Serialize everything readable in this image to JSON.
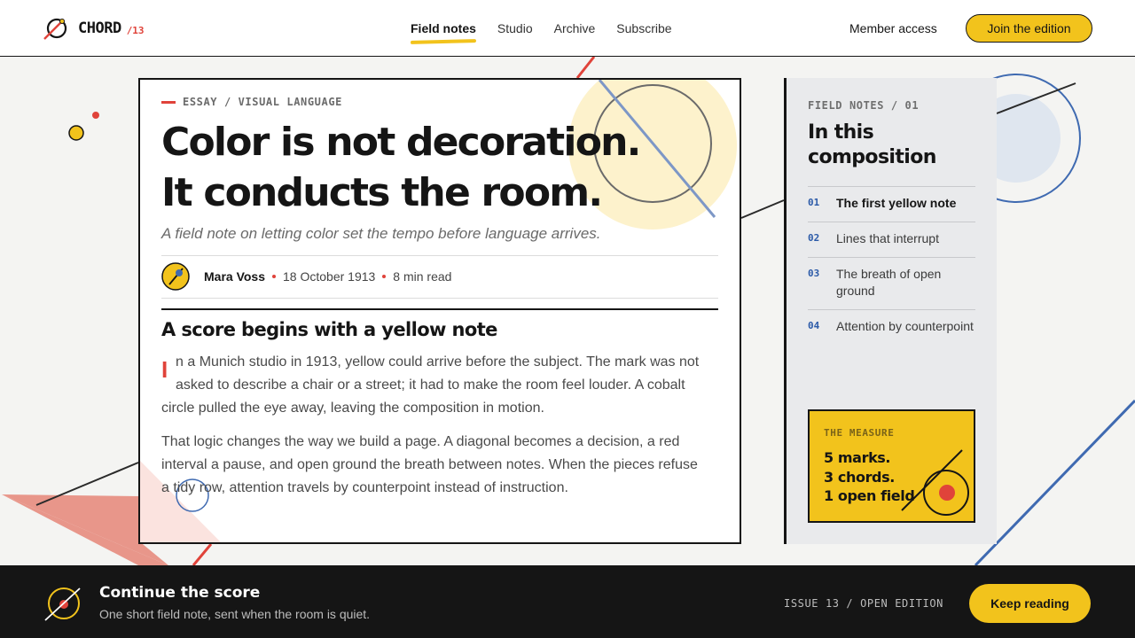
{
  "header": {
    "brand_name": "CHORD",
    "brand_issue": "/13",
    "nav": [
      {
        "label": "Field notes",
        "active": true
      },
      {
        "label": "Studio"
      },
      {
        "label": "Archive"
      },
      {
        "label": "Subscribe"
      }
    ],
    "member_link": "Member access",
    "join_button": "Join the edition"
  },
  "article": {
    "kicker": "ESSAY / VISUAL LANGUAGE",
    "headline_lines": [
      "Color is not decoration.",
      "It conducts the room."
    ],
    "subtitle": "A field note on letting color set the tempo before language arrives.",
    "author": "Mara Voss",
    "date": "18 October 1913",
    "read_time": "8 min read",
    "section_heading": "A score begins with a yellow note",
    "dropcap": "I",
    "paragraph_1": "n a Munich studio in 1913, yellow could arrive before the subject. The mark was not asked to describe a chair or a street; it had to make the room feel louder. A cobalt circle pulled the eye away, leaving the composition in motion.",
    "paragraph_2": "That logic changes the way we build a page. A diagonal becomes a decision, a red interval a pause, and open ground the breath between notes. When the pieces refuse a tidy row, attention travels by counterpoint instead of instruction."
  },
  "sidebar": {
    "label": "FIELD NOTES / 01",
    "title": "In this composition",
    "toc": [
      {
        "num": "01",
        "title": "The first yellow note",
        "current": true
      },
      {
        "num": "02",
        "title": "Lines that interrupt"
      },
      {
        "num": "03",
        "title": "The breath of open ground"
      },
      {
        "num": "04",
        "title": "Attention by counterpoint"
      }
    ],
    "measure": {
      "label": "THE MEASURE",
      "lines": [
        "5 marks.",
        "3 chords.",
        "1 open field"
      ]
    }
  },
  "footer": {
    "title": "Continue the score",
    "subtitle": "One short field note, sent when the room is quiet.",
    "issue": "ISSUE 13 / OPEN EDITION",
    "button": "Keep reading"
  },
  "colors": {
    "yellow": "#f2c31c",
    "red": "#e0433a",
    "cobalt": "#3f6ab1",
    "ink": "#151515",
    "paper": "#f4f4f2"
  }
}
